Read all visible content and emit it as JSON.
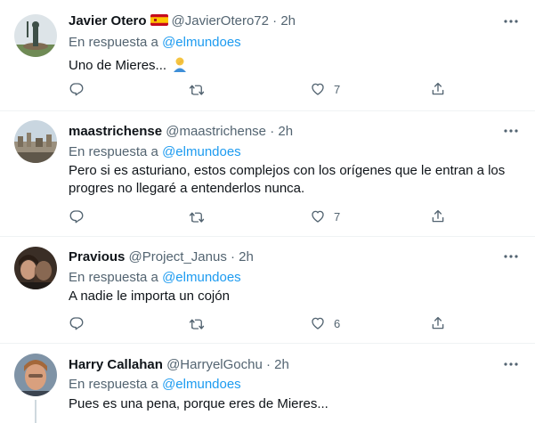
{
  "replying_prefix": "En respuesta a",
  "icons": {
    "reply": "comment-icon",
    "retweet": "retweet-icon",
    "like": "heart-icon",
    "share": "share-icon",
    "more": "more-dots-icon"
  },
  "colors": {
    "link": "#1d9bf0",
    "secondary": "#536471",
    "text": "#0f1419"
  },
  "tweets": [
    {
      "name": "Javier Otero",
      "flag": "flag-spain",
      "handle": "@JavierOtero72",
      "time": "· 2h",
      "reply_to": "@elmundoes",
      "text": "Uno de Mieres...",
      "text_emoji": "person-facepalming",
      "likes": "7"
    },
    {
      "name": "maastrichense",
      "handle": "@maastrichense",
      "time": "· 2h",
      "reply_to": "@elmundoes",
      "text": "Pero si es asturiano, estos complejos con los orígenes que le entran a los progres no llegaré a entenderlos nunca.",
      "likes": "7"
    },
    {
      "name": "Pravious",
      "handle": "@Project_Janus",
      "time": "· 2h",
      "reply_to": "@elmundoes",
      "text": "A nadie le importa un cojón",
      "likes": "6"
    },
    {
      "name": "Harry Callahan",
      "handle": "@HarryelGochu",
      "time": "· 2h",
      "reply_to": "@elmundoes",
      "text": "Pues es una pena, porque eres de Mieres..."
    }
  ]
}
